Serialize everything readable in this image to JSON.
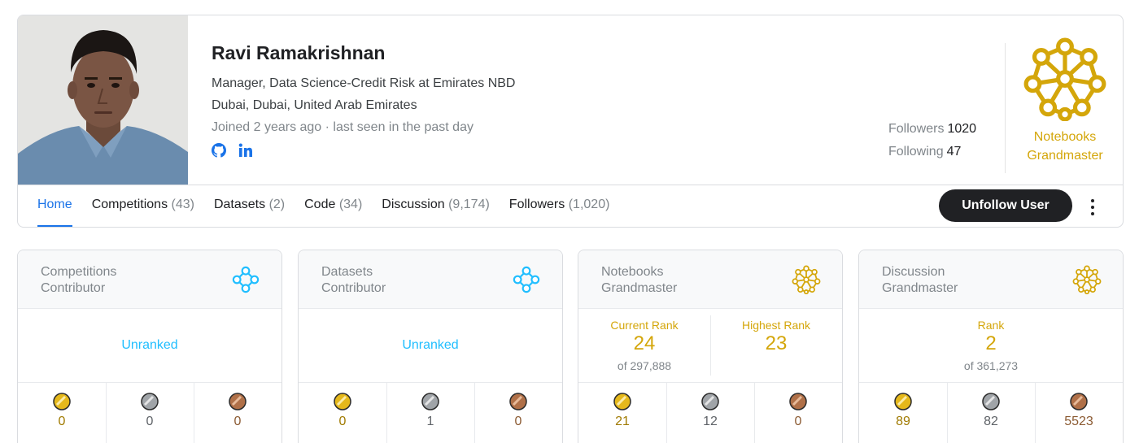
{
  "profile": {
    "name": "Ravi Ramakrishnan",
    "occupation": "Manager, Data Science-Credit Risk at Emirates NBD",
    "location": "Dubai, Dubai, United Arab Emirates",
    "joined": "Joined 2 years ago · last seen in the past day",
    "social": [
      {
        "icon": "github-icon"
      },
      {
        "icon": "linkedin-icon"
      }
    ],
    "followers_label": "Followers",
    "followers": "1020",
    "following_label": "Following",
    "following": "47",
    "tier_line1": "Notebooks",
    "tier_line2": "Grandmaster"
  },
  "tabs": [
    {
      "label": "Home",
      "count": ""
    },
    {
      "label": "Competitions",
      "count": "(43)"
    },
    {
      "label": "Datasets",
      "count": "(2)"
    },
    {
      "label": "Code",
      "count": "(34)"
    },
    {
      "label": "Discussion",
      "count": "(9,174)"
    },
    {
      "label": "Followers",
      "count": "(1,020)"
    }
  ],
  "actions": {
    "unfollow_label": "Unfollow User",
    "more_icon": "more-vert-icon"
  },
  "cards": [
    {
      "title_line1": "Competitions",
      "title_line2": "Contributor",
      "tier_icon": "contributor-icon",
      "status": "Unranked",
      "medals": {
        "gold": "0",
        "silver": "0",
        "bronze": "0"
      }
    },
    {
      "title_line1": "Datasets",
      "title_line2": "Contributor",
      "tier_icon": "contributor-icon",
      "status": "Unranked",
      "medals": {
        "gold": "0",
        "silver": "1",
        "bronze": "0"
      }
    },
    {
      "title_line1": "Notebooks",
      "title_line2": "Grandmaster",
      "tier_icon": "grandmaster-icon",
      "current_rank_label": "Current Rank",
      "current_rank": "24",
      "current_rank_of": "of 297,888",
      "highest_rank_label": "Highest Rank",
      "highest_rank": "23",
      "medals": {
        "gold": "21",
        "silver": "12",
        "bronze": "0"
      }
    },
    {
      "title_line1": "Discussion",
      "title_line2": "Grandmaster",
      "tier_icon": "grandmaster-icon",
      "rank_label": "Rank",
      "rank": "2",
      "rank_of": "of 361,273",
      "medals": {
        "gold": "89",
        "silver": "82",
        "bronze": "5523"
      }
    }
  ],
  "colors": {
    "grandmaster": "#d4a60a",
    "contributor": "#20beff",
    "active_tab": "#1a73e8",
    "gold_medal": "#e5b81b",
    "silver_medal": "#a0a4a8",
    "bronze_medal": "#b07048"
  }
}
